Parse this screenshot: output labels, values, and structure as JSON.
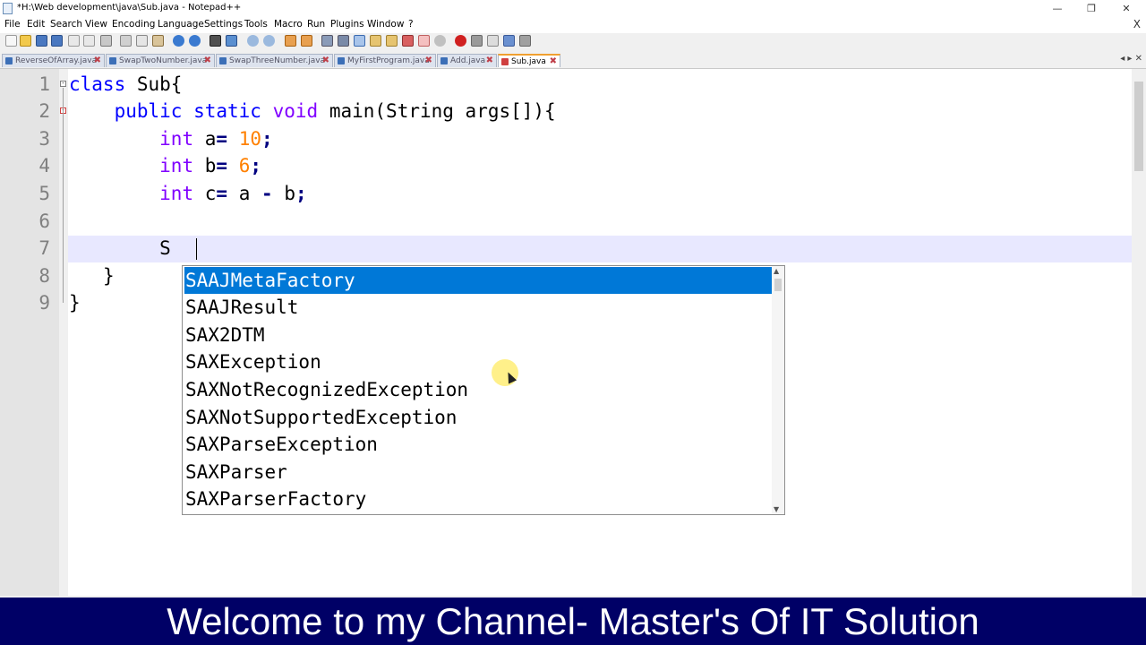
{
  "window": {
    "title": "*H:\\Web development\\java\\Sub.java - Notepad++",
    "minimize": "—",
    "restore": "❐",
    "close": "✕"
  },
  "menu": [
    "File",
    "Edit",
    "Search",
    "View",
    "Encoding",
    "Language",
    "Settings",
    "Tools",
    "Macro",
    "Run",
    "Plugins",
    "Window",
    "?"
  ],
  "menu_close": "X",
  "tabs": [
    {
      "label": "ReverseOfArray.java",
      "active": false
    },
    {
      "label": "SwapTwoNumber.java",
      "active": false
    },
    {
      "label": "SwapThreeNumber.java",
      "active": false
    },
    {
      "label": "MyFirstProgram.java",
      "active": false
    },
    {
      "label": "Add.java",
      "active": false
    },
    {
      "label": "Sub.java",
      "active": true
    }
  ],
  "tab_close": "✖",
  "tab_nav": "◂ ▸ ✕",
  "editor": {
    "line_numbers": [
      "1",
      "2",
      "3",
      "4",
      "5",
      "6",
      "7",
      "8",
      "9"
    ],
    "code": {
      "l1_kw": "class",
      "l1_rest": " Sub{",
      "l2_kw1": "public",
      "l2_kw2": "static",
      "l2_kw3": "void",
      "l2_rest": "main(String args[]){",
      "l3_kw": "int",
      "l3_var": "a",
      "l3_op": "=",
      "l3_num": "10",
      "l3_end": ";",
      "l4_kw": "int",
      "l4_var": "b",
      "l4_op": "=",
      "l4_num": "6",
      "l4_end": ";",
      "l5_kw": "int",
      "l5_var": "c",
      "l5_op": "=",
      "l5_expr1": "a",
      "l5_minus": "-",
      "l5_expr2": "b",
      "l5_end": ";",
      "l7_typed": "S",
      "l8": "}",
      "l9": "}"
    }
  },
  "autocomplete": {
    "selected_index": 0,
    "items": [
      "SAAJMetaFactory",
      "SAAJResult",
      "SAX2DTM",
      "SAXException",
      "SAXNotRecognizedException",
      "SAXNotSupportedException",
      "SAXParseException",
      "SAXParser",
      "SAXParserFactory"
    ]
  },
  "banner": "Welcome to my Channel- Master's Of IT Solution",
  "colors": {
    "selection": "#0078d7",
    "keyword": "#0000ff",
    "number": "#ff8000",
    "banner_bg": "#000066"
  }
}
